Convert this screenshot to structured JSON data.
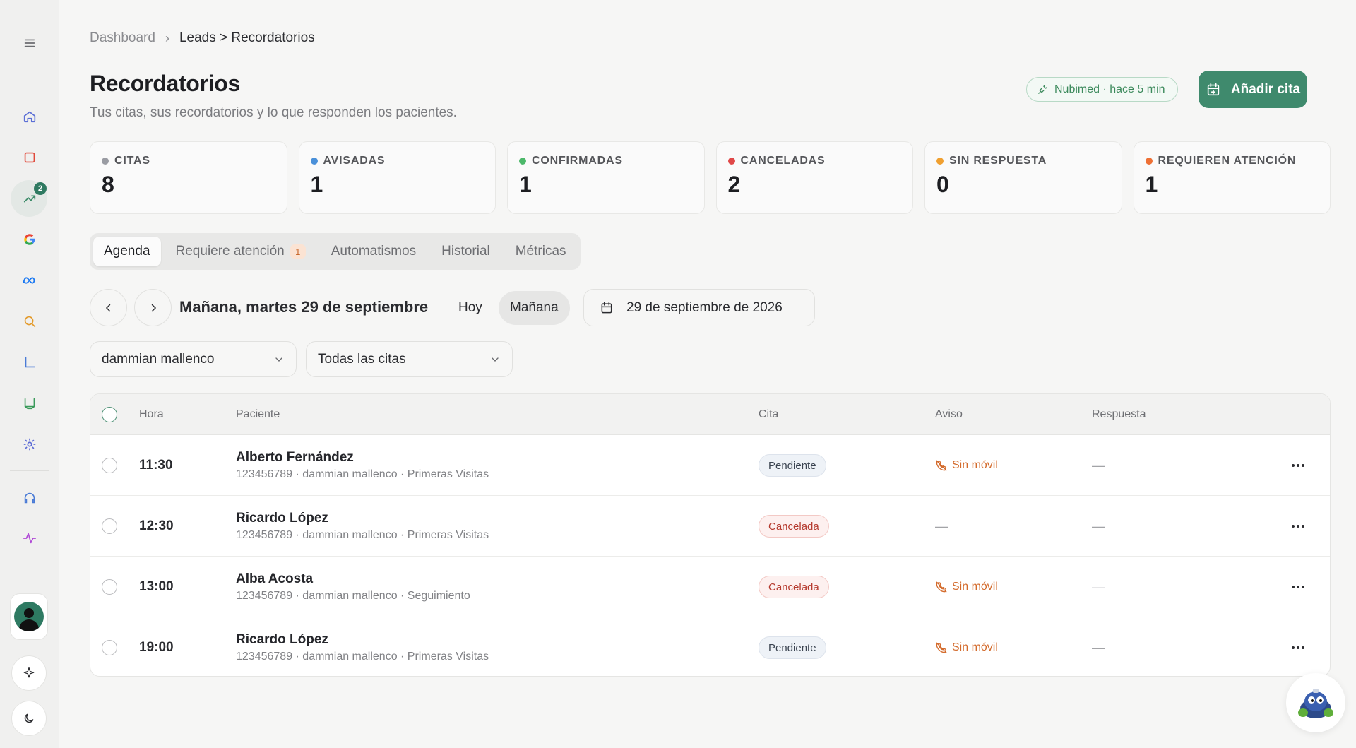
{
  "sidebar": {
    "badge_count": "2",
    "items": [
      {
        "icon": "menu-icon"
      },
      {
        "icon": "home-icon"
      },
      {
        "icon": "square-icon"
      },
      {
        "icon": "trending-icon"
      },
      {
        "icon": "google-icon"
      },
      {
        "icon": "meta-icon"
      },
      {
        "icon": "search-icon"
      },
      {
        "icon": "corner-icon"
      },
      {
        "icon": "inbox-icon"
      },
      {
        "icon": "settings-icon"
      },
      {
        "icon": "headphones-icon"
      },
      {
        "icon": "activity-icon"
      },
      {
        "icon": "sparkle-icon"
      },
      {
        "icon": "moon-icon"
      }
    ]
  },
  "breadcrumb": {
    "root": "Dashboard",
    "separator": "›",
    "current": "Leads > Recordatorios"
  },
  "header": {
    "title": "Recordatorios",
    "subtitle": "Tus citas, sus recordatorios y lo que responden los pacientes.",
    "sync_status": "Nubimed · hace 5 min",
    "add_button": "Añadir cita"
  },
  "stats": [
    {
      "label": "CITAS",
      "value": "8",
      "color": "#9a9ca3"
    },
    {
      "label": "AVISADAS",
      "value": "1",
      "color": "#4a90d9"
    },
    {
      "label": "CONFIRMADAS",
      "value": "1",
      "color": "#4cb86a"
    },
    {
      "label": "CANCELADAS",
      "value": "2",
      "color": "#e04848"
    },
    {
      "label": "SIN RESPUESTA",
      "value": "0",
      "color": "#f0a030"
    },
    {
      "label": "REQUIEREN ATENCIÓN",
      "value": "1",
      "color": "#ee7035"
    }
  ],
  "tabs": [
    {
      "label": "Agenda",
      "active": true
    },
    {
      "label": "Requiere atención",
      "count": "1"
    },
    {
      "label": "Automatismos"
    },
    {
      "label": "Historial"
    },
    {
      "label": "Métricas"
    }
  ],
  "date_nav": {
    "heading": "Mañana, martes 29 de septiembre",
    "today": "Hoy",
    "tomorrow": "Mañana",
    "picker": "29 de septiembre de 2026"
  },
  "filters": {
    "doctor": "dammian mallenco",
    "status": "Todas las citas"
  },
  "table": {
    "columns": [
      "Hora",
      "Paciente",
      "Cita",
      "Aviso",
      "Respuesta"
    ],
    "rows": [
      {
        "time": "11:30",
        "name": "Alberto Fernández",
        "meta": "123456789 · dammian mallenco · Primeras Visitas",
        "status": "Pendiente",
        "aviso": "Sin móvil",
        "respuesta": "—"
      },
      {
        "time": "12:30",
        "name": "Ricardo López",
        "meta": "123456789 · dammian mallenco · Primeras Visitas",
        "status": "Cancelada",
        "aviso": "—",
        "respuesta": "—"
      },
      {
        "time": "13:00",
        "name": "Alba Acosta",
        "meta": "123456789 · dammian mallenco · Seguimiento",
        "status": "Cancelada",
        "aviso": "Sin móvil",
        "respuesta": "—"
      },
      {
        "time": "19:00",
        "name": "Ricardo López",
        "meta": "123456789 · dammian mallenco · Primeras Visitas",
        "status": "Pendiente",
        "aviso": "Sin móvil",
        "respuesta": "—"
      }
    ]
  },
  "colors": {
    "accent": "#3f8a6d",
    "warning_text": "#d36a2b",
    "cancel_text": "#b53a2e"
  }
}
